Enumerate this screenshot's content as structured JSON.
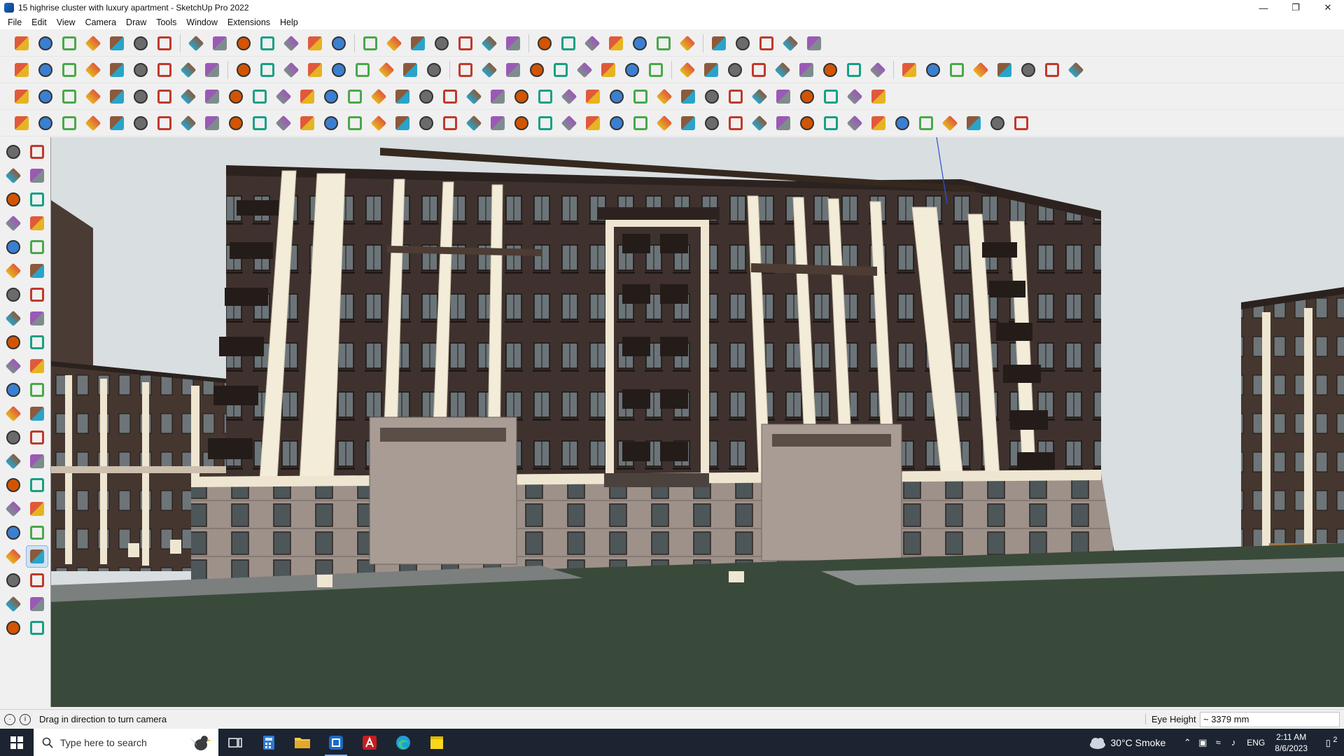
{
  "window": {
    "title": "15 highrise cluster with luxury apartment - SketchUp Pro 2022",
    "controls": [
      "—",
      "❐",
      "✕"
    ]
  },
  "menu": [
    "File",
    "Edit",
    "View",
    "Camera",
    "Draw",
    "Tools",
    "Window",
    "Extensions",
    "Help"
  ],
  "status": {
    "hint": "Drag in direction to turn camera",
    "measure_label": "Eye Height",
    "measure_value": "~ 3379 mm"
  },
  "taskbar": {
    "search_placeholder": "Type here to search",
    "weather": "30°C  Smoke",
    "language": "ENG",
    "time": "2:11 AM",
    "date": "8/6/2023",
    "notification_count": "2"
  },
  "icons": {
    "row1": [
      "zoom-extents",
      "select",
      "eraser",
      "pencil-line",
      "lasso",
      "shape",
      "push-pull",
      "follow-me",
      "move",
      "rotate",
      "scale",
      "tape-measure",
      "text",
      "paint-bucket",
      "orbit",
      "pan",
      "zoom",
      "zoom-window",
      "section-plane",
      "component",
      "layer",
      "style",
      "user",
      "warehouse",
      "ext-warehouse",
      "solar-north",
      "sandbox-up",
      "sandbox-down",
      "sandbox-tool",
      "section-display",
      "undo",
      "redo",
      "trimble"
    ],
    "row2": [
      "box-iso",
      "box-top",
      "box-front",
      "paint",
      "3d-arrow-a",
      "3d-arrow-b",
      "3d-arrow-c",
      "3d-arrow-d",
      "3d-arrow-e",
      "3d-arrow-f",
      "3d-arrow-g",
      "curve",
      "face-a",
      "face-b",
      "face-c",
      "green-box",
      "cube-move",
      "house-a",
      "house-b",
      "house-c",
      "house-d",
      "house-e",
      "fx",
      "egg",
      "pencil-red",
      "hex-a",
      "circle",
      "hex-b",
      "ellipse",
      "para",
      "arc",
      "chain",
      "lasso-b",
      "cloud",
      "ring",
      "red-knife",
      "eraser-pink",
      "cone-a",
      "grid-a",
      "crate-a",
      "crate-b",
      "glove",
      "tile",
      "panel"
    ],
    "row3": [
      "blue-tile",
      "cyan-tile",
      "yellow-tile",
      "green-tile",
      "red-tile",
      "curl",
      "red-square",
      "stripe",
      "flag",
      "crate",
      "hook",
      "arc-a",
      "red-plus",
      "green-plus",
      "blue-x",
      "cone-b",
      "cone-c",
      "warning",
      "ring-a",
      "ring-b",
      "ring-c",
      "compass",
      "mug",
      "red-arrow",
      "green-grid",
      "stairs",
      "swap",
      "chair",
      "red-shape",
      "gears",
      "window",
      "orange-grid",
      "orange-grid-b",
      "orange-grid-c",
      "red-x",
      "dots",
      "grid-b"
    ],
    "row4": [
      "draw-a",
      "draw-b",
      "draw-c",
      "draw-d",
      "draw-e",
      "draw-f",
      "draw-g",
      "draw-h",
      "draw-i",
      "draw-j",
      "draw-k",
      "draw-l",
      "draw-m",
      "draw-n",
      "draw-o",
      "draw-p",
      "draw-q",
      "draw-r",
      "draw-s",
      "draw-t",
      "draw-u",
      "draw-v",
      "draw-w",
      "draw-x",
      "draw-y",
      "draw-z",
      "draw-aa",
      "draw-ab",
      "draw-ac",
      "draw-ad",
      "draw-ae",
      "draw-af",
      "draw-ag",
      "draw-ah",
      "draw-ai",
      "draw-aj",
      "draw-ak",
      "draw-al",
      "draw-am",
      "draw-an",
      "draw-ao",
      "draw-ap",
      "draw-aq"
    ],
    "left": [
      "select",
      "orbit-small",
      "paint-bucket",
      "eraser",
      "component",
      "tape",
      "pencil",
      "freehand",
      "rectangle",
      "rotated-rect",
      "circle",
      "polygon",
      "arc",
      "pie",
      "arc-2",
      "arc-3",
      "move",
      "push-pull",
      "rotate",
      "follow-me",
      "scale",
      "offset",
      "tape-measure",
      "dimension",
      "protractor",
      "text",
      "axes",
      "3d-text",
      "orbit",
      "pan",
      "zoom",
      "zoom-window",
      "zoom-extents",
      "prev-view",
      "walk",
      "look-around",
      "footprint",
      "position-camera",
      "section-plane",
      "section-display",
      "layer-a",
      "layer-b"
    ]
  },
  "colors": {
    "sky": "#d9dee1",
    "facade_dark": "#3f322e",
    "pillar_cream": "#f3ecd9",
    "base_stone": "#9c8f89",
    "ground": "#3a4a3a",
    "taskbar": "#1c2431"
  }
}
